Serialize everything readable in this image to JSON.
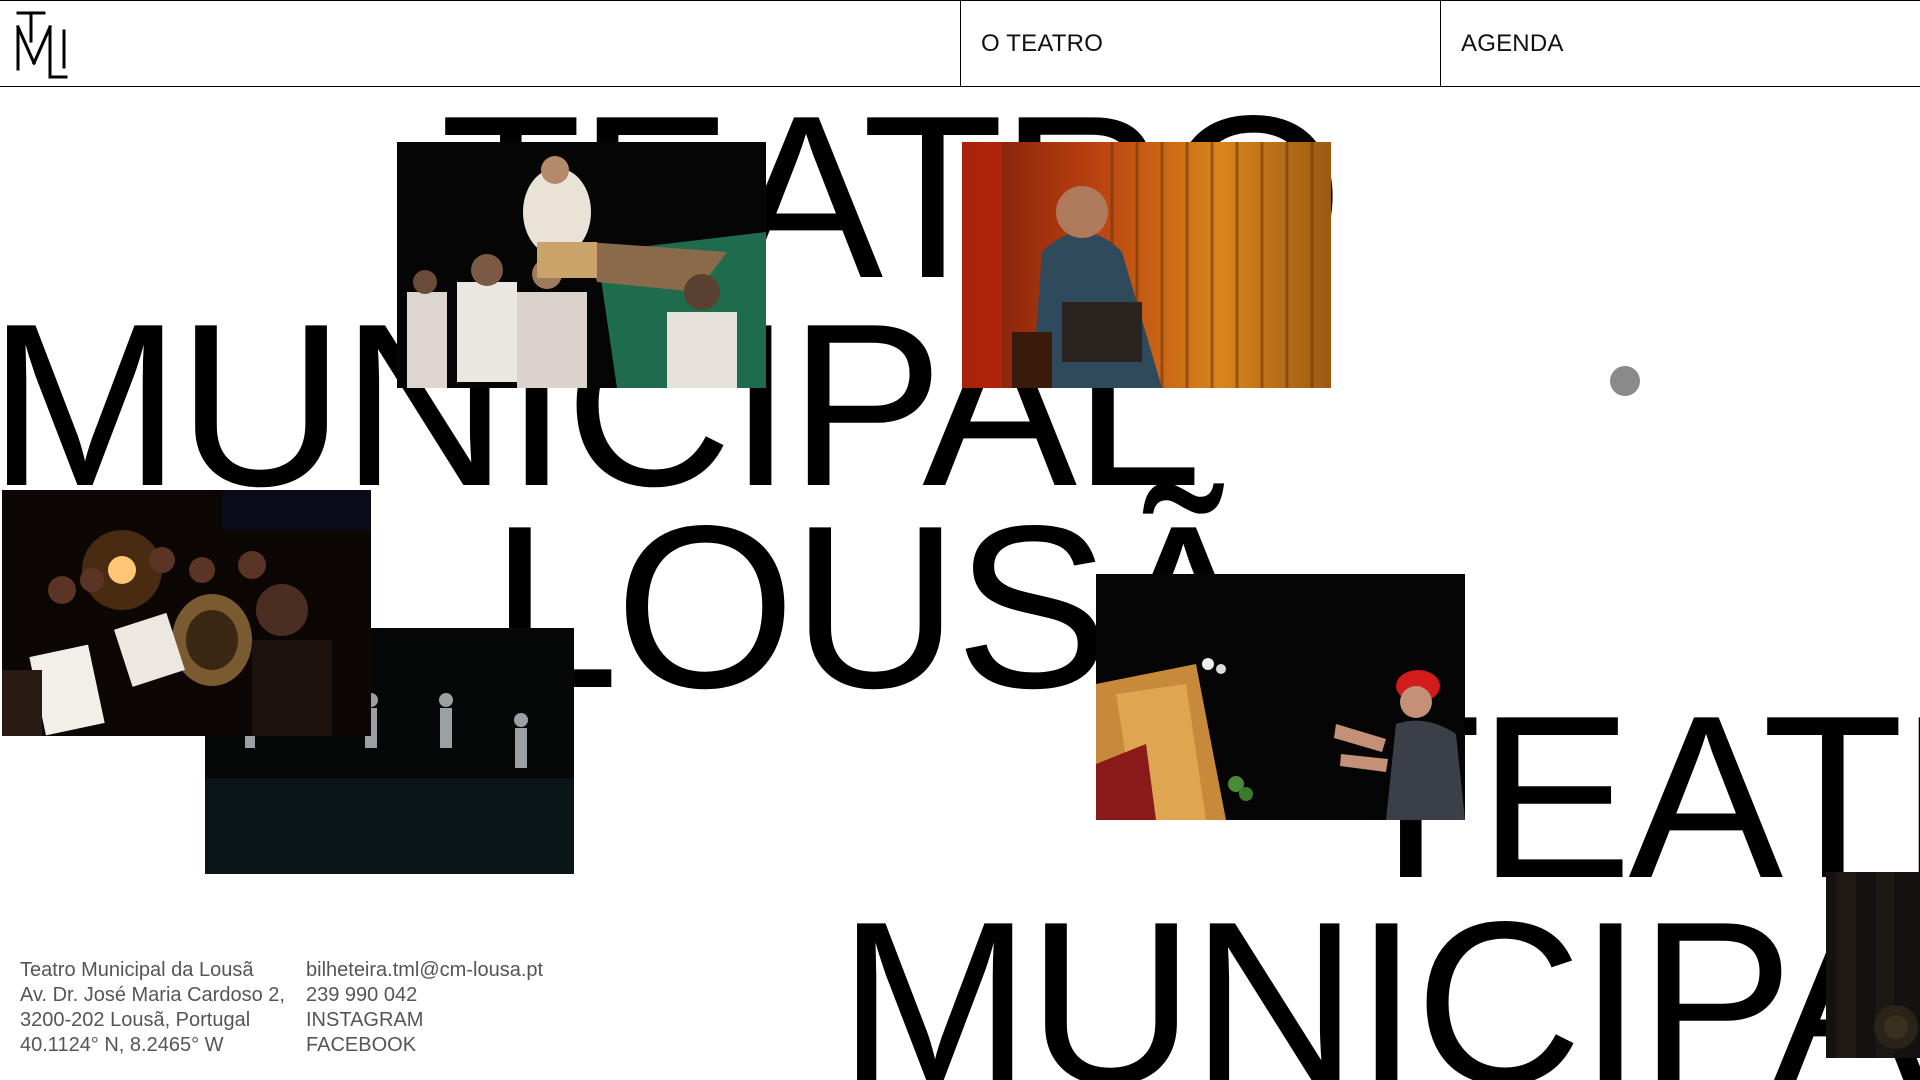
{
  "header": {
    "logo_alt": "TML",
    "nav": {
      "o_teatro": "O TEATRO",
      "agenda": "AGENDA"
    }
  },
  "hero": {
    "line1": "TEATRO",
    "line2": "MUNICIPAL",
    "line3": "LOUSÃ",
    "line4": "TEATRO",
    "line5": "MUNICIPAL"
  },
  "footer": {
    "address": {
      "name": "Teatro Municipal da Lousã",
      "street": "Av. Dr. José Maria Cardoso 2,",
      "city": "3200-202 Lousã, Portugal",
      "coords": "40.1124° N, 8.2465° W"
    },
    "contact": {
      "email": "bilheteira.tml@cm-lousa.pt",
      "phone": "239 990 042",
      "instagram": "INSTAGRAM",
      "facebook": "FACEBOOK"
    }
  },
  "colors": {
    "background": "#ffffff",
    "text": "#000000",
    "footer_text": "#555555",
    "cursor": "#8a8a8a"
  },
  "icons": {
    "logo": "tml-monogram-icon"
  }
}
